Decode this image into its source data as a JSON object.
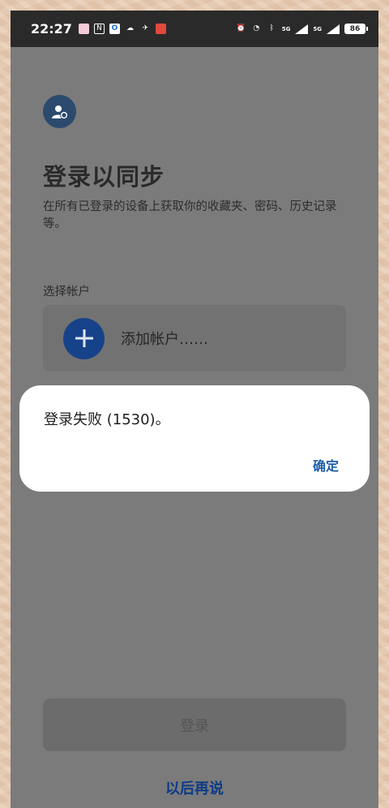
{
  "status_bar": {
    "time": "22:27",
    "battery": "86",
    "network": "5G"
  },
  "page": {
    "title": "登录以同步",
    "subtitle": "在所有已登录的设备上获取你的收藏夹、密码、历史记录等。",
    "section_label": "选择帐户",
    "add_account_label": "添加帐户……",
    "login_button": "登录",
    "later_link": "以后再说"
  },
  "dialog": {
    "message": "登录失败 (1530)。",
    "ok_button": "确定"
  },
  "colors": {
    "accent": "#16428a",
    "link": "#0c3b86",
    "dialog_button": "#1f5ea8",
    "scrim": "#7b7b7b"
  }
}
